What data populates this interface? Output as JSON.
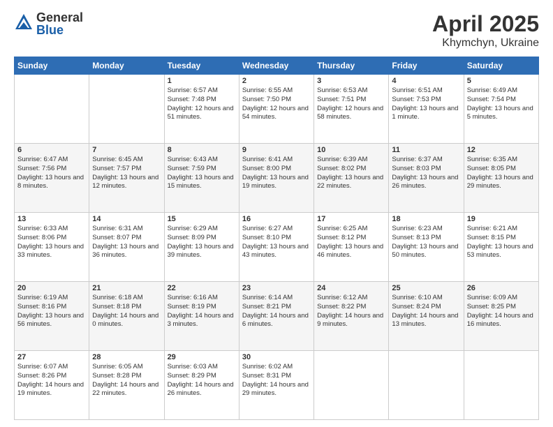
{
  "logo": {
    "general": "General",
    "blue": "Blue"
  },
  "title": {
    "month_year": "April 2025",
    "location": "Khymchyn, Ukraine"
  },
  "weekdays": [
    "Sunday",
    "Monday",
    "Tuesday",
    "Wednesday",
    "Thursday",
    "Friday",
    "Saturday"
  ],
  "weeks": [
    [
      {
        "day": "",
        "content": ""
      },
      {
        "day": "",
        "content": ""
      },
      {
        "day": "1",
        "content": "Sunrise: 6:57 AM\nSunset: 7:48 PM\nDaylight: 12 hours and 51 minutes."
      },
      {
        "day": "2",
        "content": "Sunrise: 6:55 AM\nSunset: 7:50 PM\nDaylight: 12 hours and 54 minutes."
      },
      {
        "day": "3",
        "content": "Sunrise: 6:53 AM\nSunset: 7:51 PM\nDaylight: 12 hours and 58 minutes."
      },
      {
        "day": "4",
        "content": "Sunrise: 6:51 AM\nSunset: 7:53 PM\nDaylight: 13 hours and 1 minute."
      },
      {
        "day": "5",
        "content": "Sunrise: 6:49 AM\nSunset: 7:54 PM\nDaylight: 13 hours and 5 minutes."
      }
    ],
    [
      {
        "day": "6",
        "content": "Sunrise: 6:47 AM\nSunset: 7:56 PM\nDaylight: 13 hours and 8 minutes."
      },
      {
        "day": "7",
        "content": "Sunrise: 6:45 AM\nSunset: 7:57 PM\nDaylight: 13 hours and 12 minutes."
      },
      {
        "day": "8",
        "content": "Sunrise: 6:43 AM\nSunset: 7:59 PM\nDaylight: 13 hours and 15 minutes."
      },
      {
        "day": "9",
        "content": "Sunrise: 6:41 AM\nSunset: 8:00 PM\nDaylight: 13 hours and 19 minutes."
      },
      {
        "day": "10",
        "content": "Sunrise: 6:39 AM\nSunset: 8:02 PM\nDaylight: 13 hours and 22 minutes."
      },
      {
        "day": "11",
        "content": "Sunrise: 6:37 AM\nSunset: 8:03 PM\nDaylight: 13 hours and 26 minutes."
      },
      {
        "day": "12",
        "content": "Sunrise: 6:35 AM\nSunset: 8:05 PM\nDaylight: 13 hours and 29 minutes."
      }
    ],
    [
      {
        "day": "13",
        "content": "Sunrise: 6:33 AM\nSunset: 8:06 PM\nDaylight: 13 hours and 33 minutes."
      },
      {
        "day": "14",
        "content": "Sunrise: 6:31 AM\nSunset: 8:07 PM\nDaylight: 13 hours and 36 minutes."
      },
      {
        "day": "15",
        "content": "Sunrise: 6:29 AM\nSunset: 8:09 PM\nDaylight: 13 hours and 39 minutes."
      },
      {
        "day": "16",
        "content": "Sunrise: 6:27 AM\nSunset: 8:10 PM\nDaylight: 13 hours and 43 minutes."
      },
      {
        "day": "17",
        "content": "Sunrise: 6:25 AM\nSunset: 8:12 PM\nDaylight: 13 hours and 46 minutes."
      },
      {
        "day": "18",
        "content": "Sunrise: 6:23 AM\nSunset: 8:13 PM\nDaylight: 13 hours and 50 minutes."
      },
      {
        "day": "19",
        "content": "Sunrise: 6:21 AM\nSunset: 8:15 PM\nDaylight: 13 hours and 53 minutes."
      }
    ],
    [
      {
        "day": "20",
        "content": "Sunrise: 6:19 AM\nSunset: 8:16 PM\nDaylight: 13 hours and 56 minutes."
      },
      {
        "day": "21",
        "content": "Sunrise: 6:18 AM\nSunset: 8:18 PM\nDaylight: 14 hours and 0 minutes."
      },
      {
        "day": "22",
        "content": "Sunrise: 6:16 AM\nSunset: 8:19 PM\nDaylight: 14 hours and 3 minutes."
      },
      {
        "day": "23",
        "content": "Sunrise: 6:14 AM\nSunset: 8:21 PM\nDaylight: 14 hours and 6 minutes."
      },
      {
        "day": "24",
        "content": "Sunrise: 6:12 AM\nSunset: 8:22 PM\nDaylight: 14 hours and 9 minutes."
      },
      {
        "day": "25",
        "content": "Sunrise: 6:10 AM\nSunset: 8:24 PM\nDaylight: 14 hours and 13 minutes."
      },
      {
        "day": "26",
        "content": "Sunrise: 6:09 AM\nSunset: 8:25 PM\nDaylight: 14 hours and 16 minutes."
      }
    ],
    [
      {
        "day": "27",
        "content": "Sunrise: 6:07 AM\nSunset: 8:26 PM\nDaylight: 14 hours and 19 minutes."
      },
      {
        "day": "28",
        "content": "Sunrise: 6:05 AM\nSunset: 8:28 PM\nDaylight: 14 hours and 22 minutes."
      },
      {
        "day": "29",
        "content": "Sunrise: 6:03 AM\nSunset: 8:29 PM\nDaylight: 14 hours and 26 minutes."
      },
      {
        "day": "30",
        "content": "Sunrise: 6:02 AM\nSunset: 8:31 PM\nDaylight: 14 hours and 29 minutes."
      },
      {
        "day": "",
        "content": ""
      },
      {
        "day": "",
        "content": ""
      },
      {
        "day": "",
        "content": ""
      }
    ]
  ]
}
